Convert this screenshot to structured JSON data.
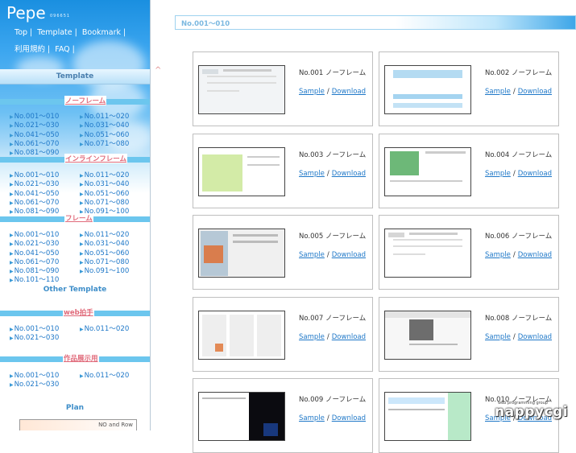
{
  "site": {
    "title": "Pepe",
    "subtitle": "096651"
  },
  "nav": [
    {
      "label": "Top"
    },
    {
      "label": "Template"
    },
    {
      "label": "Bookmark"
    },
    {
      "label": "利用規約"
    },
    {
      "label": "FAQ"
    }
  ],
  "sidebar": {
    "template_heading": "Template",
    "noframe": {
      "label": "ノーフレーム",
      "left": [
        "No.001～010",
        "No.021～030",
        "No.041～050",
        "No.061～070",
        "No.081～090"
      ],
      "right": [
        "No.011～020",
        "No.031～040",
        "No.051～060",
        "No.071～080"
      ]
    },
    "inline": {
      "label": "インラインフレーム",
      "left": [
        "No.001～010",
        "No.021～030",
        "No.041～050",
        "No.061～070",
        "No.081～090"
      ],
      "right": [
        "No.011～020",
        "No.031～040",
        "No.051～060",
        "No.071～080",
        "No.091～100"
      ]
    },
    "frame": {
      "label": "フレーム",
      "left": [
        "No.001～010",
        "No.021～030",
        "No.041～050",
        "No.061～070",
        "No.081～090",
        "No.101～110"
      ],
      "right": [
        "No.011～020",
        "No.031～040",
        "No.051～060",
        "No.071～080",
        "No.091～100"
      ]
    },
    "other_heading": "Other Template",
    "web": {
      "label": "web拍手",
      "left": [
        "No.001～010",
        "No.021～030"
      ],
      "right": [
        "No.011～020"
      ]
    },
    "works": {
      "label": "作品展示用",
      "left": [
        "No.001～010",
        "No.021～030"
      ],
      "right": [
        "No.011～020"
      ]
    },
    "plan_heading": "Plan",
    "plan_banner": "NO and Row"
  },
  "main": {
    "header": "No.001～010",
    "sample_label": "Sample",
    "download_label": "Download",
    "slash": "/",
    "cards": [
      {
        "no": "No.001 ノーフレーム"
      },
      {
        "no": "No.002 ノーフレーム"
      },
      {
        "no": "No.003 ノーフレーム"
      },
      {
        "no": "No.004 ノーフレーム"
      },
      {
        "no": "No.005 ノーフレーム"
      },
      {
        "no": "No.006 ノーフレーム"
      },
      {
        "no": "No.007 ノーフレーム"
      },
      {
        "no": "No.008 ノーフレーム"
      },
      {
        "no": "No.009 ノーフレーム"
      },
      {
        "no": "No.010 ノーフレーム"
      }
    ]
  },
  "watermark": {
    "text": "nappycgi",
    "sub": "web programming group"
  },
  "colors": {
    "accent": "#1f78c8",
    "category_bar": "#6cc6ee",
    "category_label": "#e06a7a"
  }
}
